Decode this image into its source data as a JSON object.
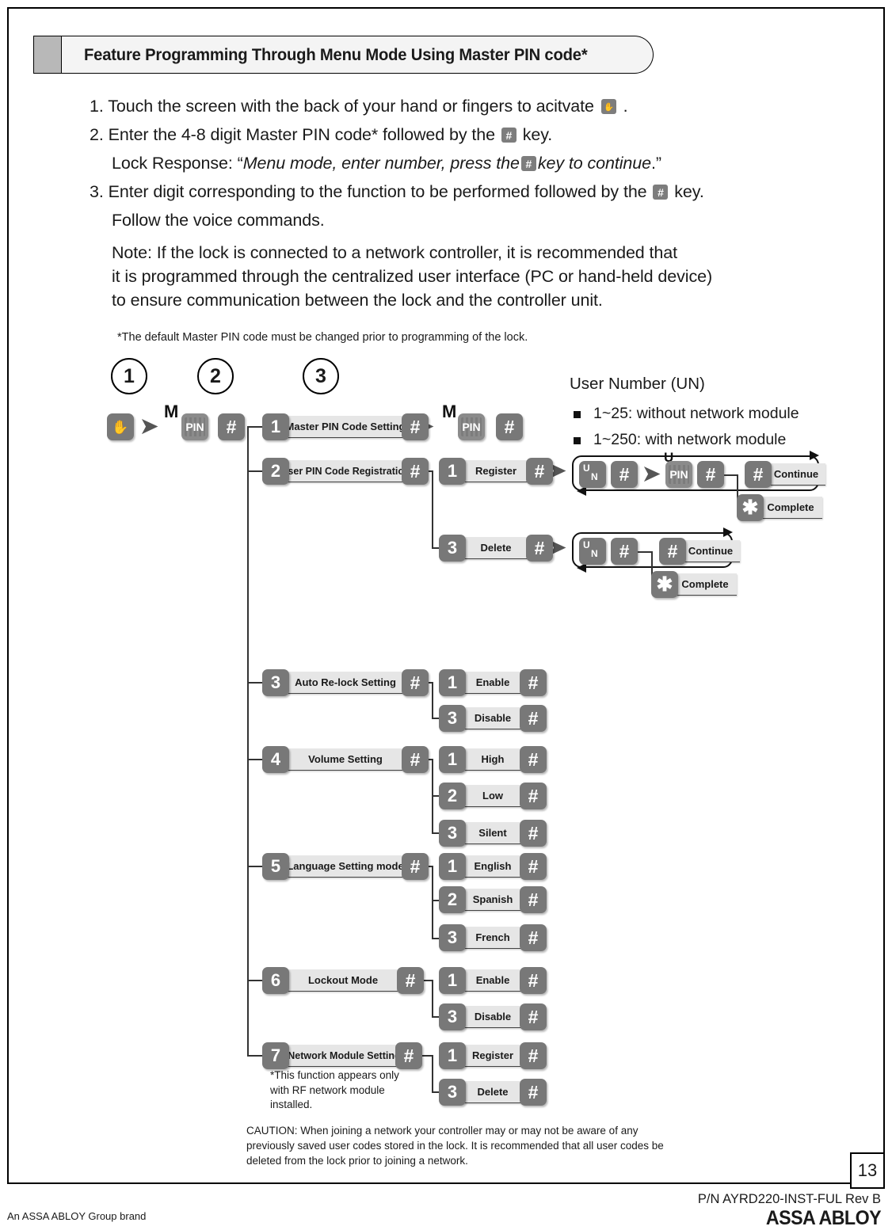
{
  "header": {
    "title": "Feature Programming Through Menu Mode Using Master PIN code*"
  },
  "instructions": {
    "step1_a": "1. Touch the screen with the back of your hand or fingers to acitvate",
    "step1_b": ".",
    "step2_a": "2. Enter the 4-8 digit Master PIN code* followed by the",
    "step2_b": "key.",
    "lock_response_a": "Lock Response: “",
    "lock_response_it1": "Menu mode, enter number, press the",
    "lock_response_it2": "key to continue",
    "lock_response_b": ".”",
    "step3_a": "3. Enter digit corresponding to the function to be performed followed by the",
    "step3_b": "key.",
    "step3_c": "Follow the voice commands.",
    "note_l1": "Note: If the lock is connected to a network controller, it is recommended that",
    "note_l2": "it is programmed through the centralized user interface (PC or hand-held device)",
    "note_l3": "to ensure communication between the lock and the controller unit.",
    "footnote": "*The default Master PIN code must be changed prior to programming of the lock."
  },
  "steps": [
    {
      "label": "1"
    },
    {
      "label": "2"
    },
    {
      "label": "3"
    }
  ],
  "keys": {
    "hand": "✋",
    "hash": "#",
    "star": "✱",
    "pin": "PIN",
    "m": "M",
    "u": "U",
    "n": "N",
    "arrow": "➤"
  },
  "un_legend": {
    "title": "User Number (UN)",
    "items": [
      "1~25: without network module",
      "1~250: with network module"
    ]
  },
  "menu": [
    {
      "digit": "1",
      "label": "Master PIN Code Setting"
    },
    {
      "digit": "2",
      "label": "User PIN Code Registration"
    },
    {
      "digit": "3",
      "label": "Auto Re-lock Setting"
    },
    {
      "digit": "4",
      "label": "Volume Setting"
    },
    {
      "digit": "5",
      "label": "Language Setting mode"
    },
    {
      "digit": "6",
      "label": "Lockout Mode"
    },
    {
      "digit": "7",
      "label": "*Network Module Setting"
    }
  ],
  "submenu": {
    "user_pin": [
      {
        "digit": "1",
        "label": "Register"
      },
      {
        "digit": "3",
        "label": "Delete"
      }
    ],
    "auto_relock": [
      {
        "digit": "1",
        "label": "Enable"
      },
      {
        "digit": "3",
        "label": "Disable"
      }
    ],
    "volume": [
      {
        "digit": "1",
        "label": "High"
      },
      {
        "digit": "2",
        "label": "Low"
      },
      {
        "digit": "3",
        "label": "Silent"
      }
    ],
    "language": [
      {
        "digit": "1",
        "label": "English"
      },
      {
        "digit": "2",
        "label": "Spanish"
      },
      {
        "digit": "3",
        "label": "French"
      }
    ],
    "lockout": [
      {
        "digit": "1",
        "label": "Enable"
      },
      {
        "digit": "3",
        "label": "Disable"
      }
    ],
    "network": [
      {
        "digit": "1",
        "label": "Register"
      },
      {
        "digit": "3",
        "label": "Delete"
      }
    ]
  },
  "loops": {
    "register": {
      "continue": "Continue",
      "complete": "Complete"
    },
    "delete": {
      "continue": "Continue",
      "complete": "Complete"
    }
  },
  "notes": {
    "network_note_l1": "*This function appears only",
    "network_note_l2": "with RF network module",
    "network_note_l3": "installed.",
    "caution_l1": "CAUTION: When joining a network your controller may or may not be aware of any",
    "caution_l2": "previously saved user codes stored in the lock. It is recommended that all user codes be",
    "caution_l3": "deleted from the lock prior to joining a network."
  },
  "footer": {
    "page_number": "13",
    "part_number": "P/N AYRD220-INST-FUL Rev B",
    "group_brand": "An ASSA ABLOY Group brand",
    "logo": "ASSA ABLOY"
  }
}
